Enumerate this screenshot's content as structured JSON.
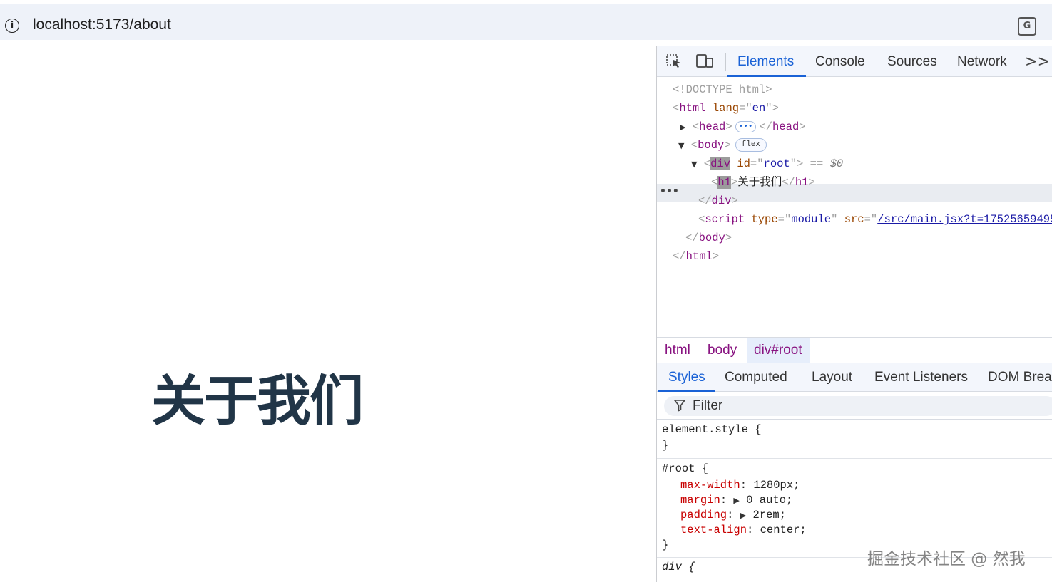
{
  "browser": {
    "url": "localhost:5173/about",
    "info_icon": "info-icon",
    "translate_icon": "translate-icon"
  },
  "page": {
    "heading": "关于我们"
  },
  "devtools": {
    "tools": [
      "inspect-element-icon",
      "device-toolbar-icon"
    ],
    "tabs": [
      "Elements",
      "Console",
      "Sources",
      "Network"
    ],
    "active_tab": "Elements",
    "more_tabs": ">>",
    "dom": {
      "doctype": "<!DOCTYPE html>",
      "html_open_tag": "html",
      "html_attr": "lang",
      "html_attr_value": "en",
      "head_tag": "head",
      "body_tag": "body",
      "body_badge": "flex",
      "div_tag": "div",
      "div_attr": "id",
      "div_attr_value": "root",
      "selected_marker": "== $0",
      "h1_tag": "h1",
      "h1_text": "关于我们",
      "script_tag": "script",
      "script_type_attr": "type",
      "script_type_value": "module",
      "script_src_attr": "src",
      "script_src_value": "/src/main.jsx?t=175256594951",
      "row_menu": "•••"
    },
    "breadcrumb": [
      "html",
      "body",
      "div#root"
    ],
    "active_crumb": "div#root",
    "subtabs": [
      "Styles",
      "Computed",
      "Layout",
      "Event Listeners",
      "DOM Brea"
    ],
    "active_subtab": "Styles",
    "filter_placeholder": "Filter",
    "styles": {
      "element_style_selector": "element.style {",
      "close_brace": "}",
      "root_selector": "#root {",
      "root_props": [
        {
          "name": "max-width",
          "value": "1280px;",
          "expandable": false
        },
        {
          "name": "margin",
          "value": "0 auto;",
          "expandable": true
        },
        {
          "name": "padding",
          "value": "2rem;",
          "expandable": true
        },
        {
          "name": "text-align",
          "value": "center;",
          "expandable": false
        }
      ],
      "div_selector": "div {"
    }
  },
  "watermark": "掘金技术社区 @ 然我"
}
